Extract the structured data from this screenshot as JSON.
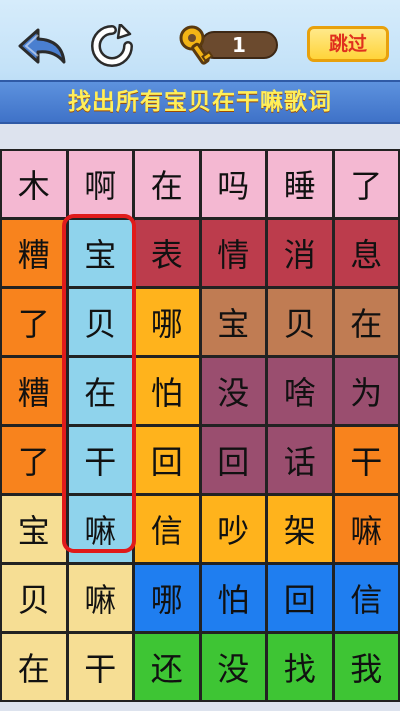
{
  "header": {
    "key_count": "1",
    "skip_label": "跳过",
    "back_icon": "back-arrow-icon",
    "refresh_icon": "refresh-icon",
    "key_icon": "key-icon"
  },
  "task_title": "找出所有宝贝在干嘛歌词",
  "colors": {
    "pink": "#f4b8d2",
    "orange": "#f8831d",
    "lightblue": "#8fd3ec",
    "crimson": "#bc3c4c",
    "amber": "#ffb31c",
    "tan": "#c07c53",
    "plum": "#9a4e6f",
    "cream": "#f6de94",
    "blue": "#1f7ef0",
    "green": "#3ec534",
    "selection": "#e01b1b"
  },
  "grid": {
    "rows": [
      [
        {
          "ch": "木",
          "c": "pink"
        },
        {
          "ch": "啊",
          "c": "pink"
        },
        {
          "ch": "在",
          "c": "pink"
        },
        {
          "ch": "吗",
          "c": "pink"
        },
        {
          "ch": "睡",
          "c": "pink"
        },
        {
          "ch": "了",
          "c": "pink"
        }
      ],
      [
        {
          "ch": "糟",
          "c": "orange"
        },
        {
          "ch": "宝",
          "c": "lightblue"
        },
        {
          "ch": "表",
          "c": "crimson"
        },
        {
          "ch": "情",
          "c": "crimson"
        },
        {
          "ch": "消",
          "c": "crimson"
        },
        {
          "ch": "息",
          "c": "crimson"
        }
      ],
      [
        {
          "ch": "了",
          "c": "orange"
        },
        {
          "ch": "贝",
          "c": "lightblue"
        },
        {
          "ch": "哪",
          "c": "amber"
        },
        {
          "ch": "宝",
          "c": "tan"
        },
        {
          "ch": "贝",
          "c": "tan"
        },
        {
          "ch": "在",
          "c": "tan"
        }
      ],
      [
        {
          "ch": "糟",
          "c": "orange"
        },
        {
          "ch": "在",
          "c": "lightblue"
        },
        {
          "ch": "怕",
          "c": "amber"
        },
        {
          "ch": "没",
          "c": "plum"
        },
        {
          "ch": "啥",
          "c": "plum"
        },
        {
          "ch": "为",
          "c": "plum"
        }
      ],
      [
        {
          "ch": "了",
          "c": "orange"
        },
        {
          "ch": "干",
          "c": "lightblue"
        },
        {
          "ch": "回",
          "c": "amber"
        },
        {
          "ch": "回",
          "c": "plum"
        },
        {
          "ch": "话",
          "c": "plum"
        },
        {
          "ch": "干",
          "c": "orange"
        }
      ],
      [
        {
          "ch": "宝",
          "c": "cream"
        },
        {
          "ch": "嘛",
          "c": "lightblue"
        },
        {
          "ch": "信",
          "c": "amber"
        },
        {
          "ch": "吵",
          "c": "amber"
        },
        {
          "ch": "架",
          "c": "amber"
        },
        {
          "ch": "嘛",
          "c": "orange"
        }
      ],
      [
        {
          "ch": "贝",
          "c": "cream"
        },
        {
          "ch": "嘛",
          "c": "cream"
        },
        {
          "ch": "哪",
          "c": "blue"
        },
        {
          "ch": "怕",
          "c": "blue"
        },
        {
          "ch": "回",
          "c": "blue"
        },
        {
          "ch": "信",
          "c": "blue"
        }
      ],
      [
        {
          "ch": "在",
          "c": "cream"
        },
        {
          "ch": "干",
          "c": "cream"
        },
        {
          "ch": "还",
          "c": "green"
        },
        {
          "ch": "没",
          "c": "green"
        },
        {
          "ch": "找",
          "c": "green"
        },
        {
          "ch": "我",
          "c": "green"
        }
      ]
    ]
  }
}
